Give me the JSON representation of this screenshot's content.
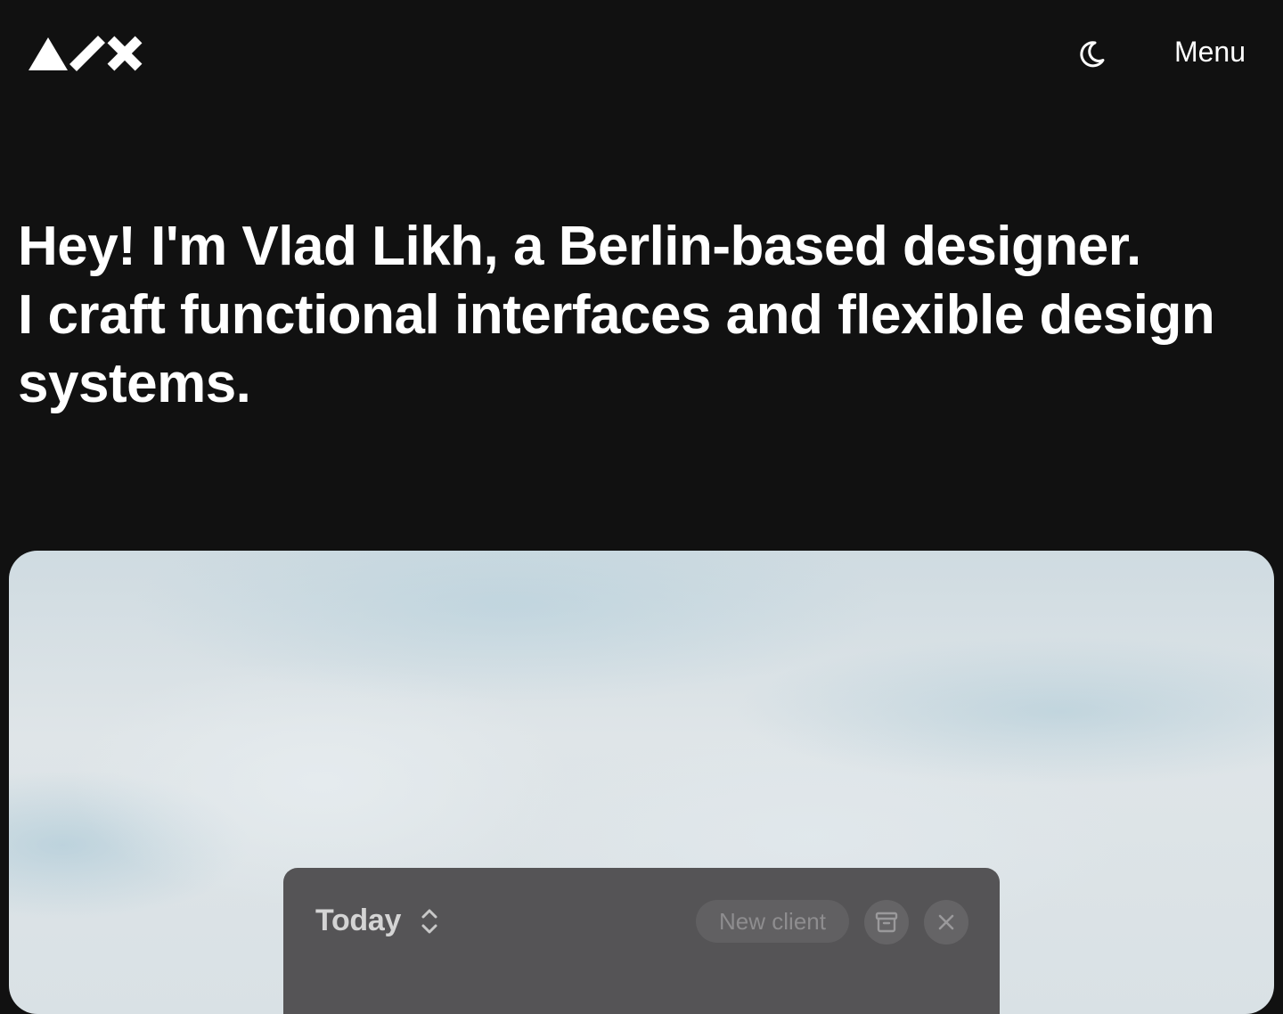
{
  "header": {
    "logo_label": "AVX",
    "theme_toggle_icon": "moon-icon",
    "menu_label": "Menu"
  },
  "hero": {
    "lines": [
      "Hey! I'm Vlad Likh, a Berlin-based designer.",
      "I craft functional interfaces and flexible design",
      "systems."
    ]
  },
  "showcase": {
    "toolbar": {
      "title": "Today",
      "sort_icon": "chevron-up-down-icon",
      "new_client_label": "New client",
      "archive_icon": "archive-icon",
      "close_icon": "close-icon"
    }
  },
  "colors": {
    "background": "#111111",
    "text": "#ffffff",
    "toolbar_bg": "#555456",
    "button_bg": "#616062",
    "muted_text": "#8e8d8f"
  }
}
